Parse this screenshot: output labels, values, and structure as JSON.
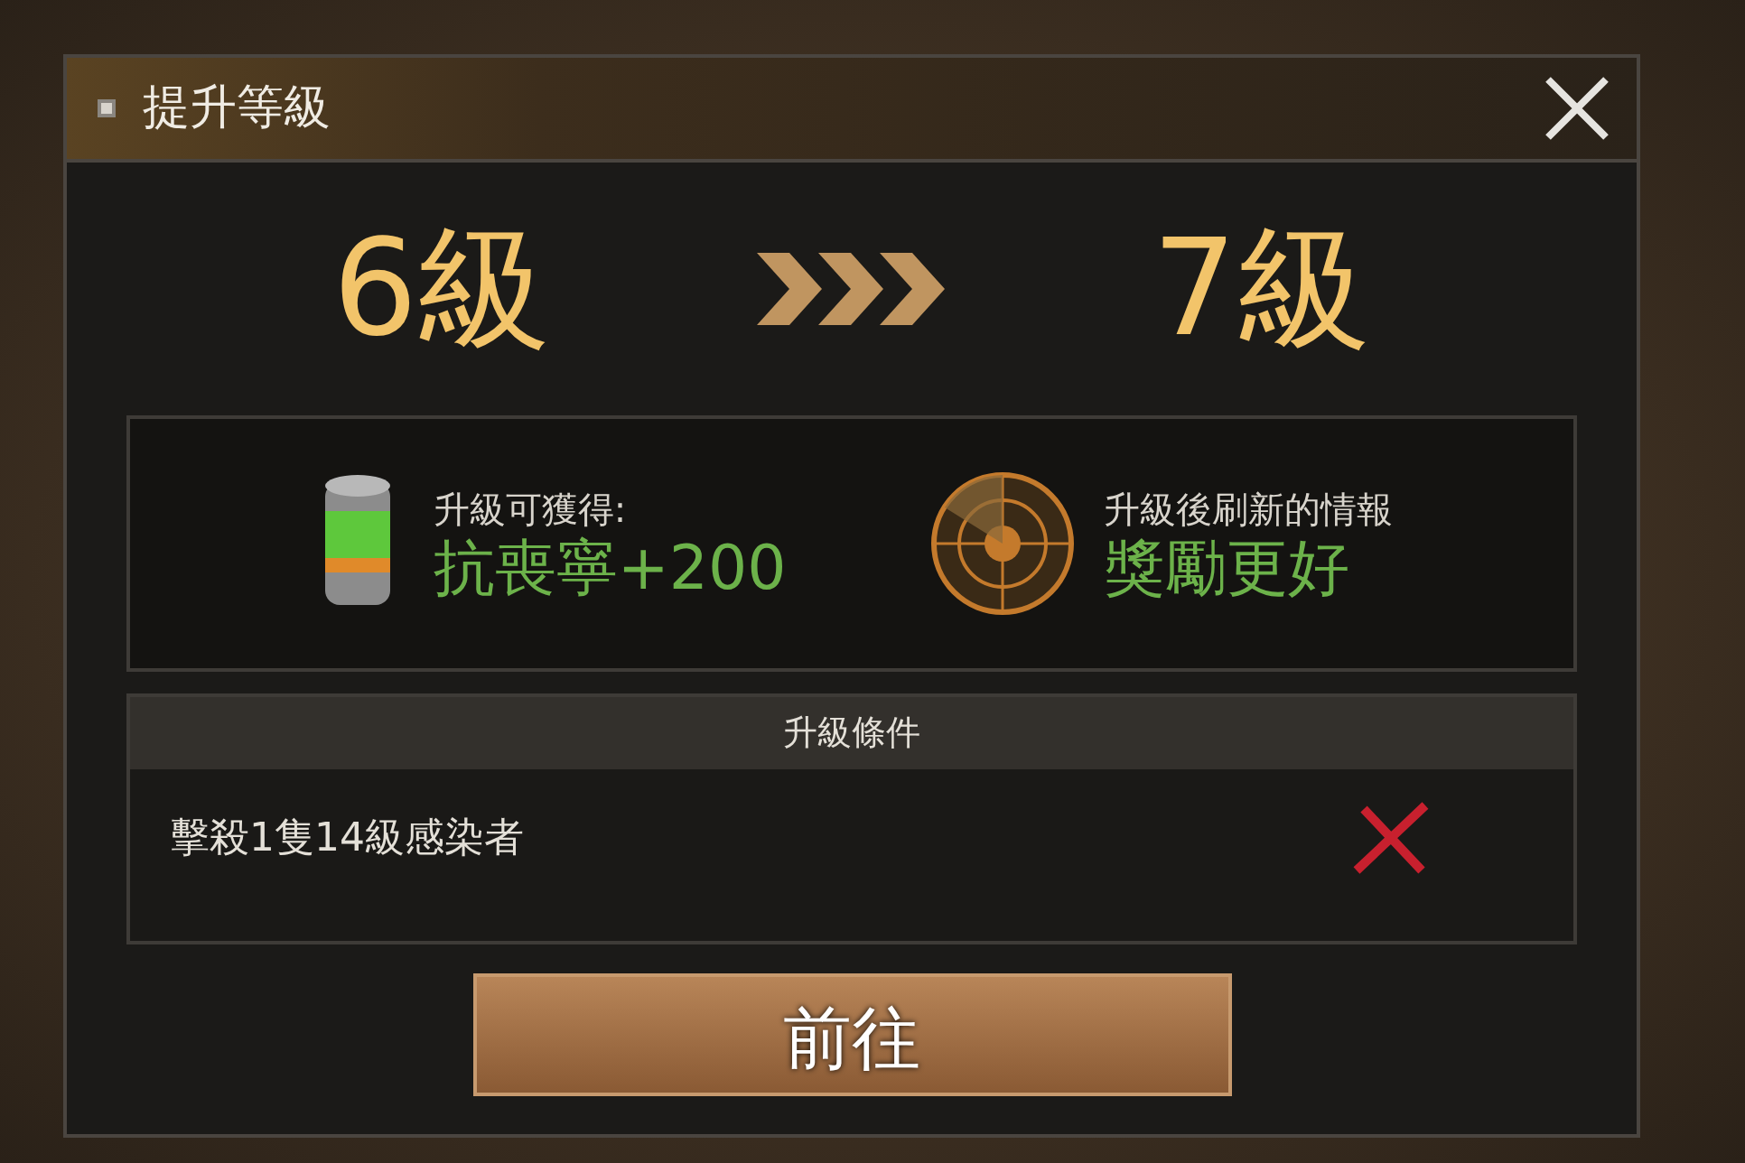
{
  "dialog": {
    "title": "提升等級"
  },
  "levels": {
    "current": "6級",
    "next": "7級"
  },
  "rewards": [
    {
      "kind": "item",
      "label": "升級可獲得:",
      "value": "抗喪寧+200"
    },
    {
      "kind": "radar",
      "label": "升級後刷新的情報",
      "value": "獎勵更好"
    }
  ],
  "conditions": {
    "header": "升級條件",
    "items": [
      {
        "text": "擊殺1隻14級感染者",
        "completed": false
      }
    ]
  },
  "button": "前往"
}
